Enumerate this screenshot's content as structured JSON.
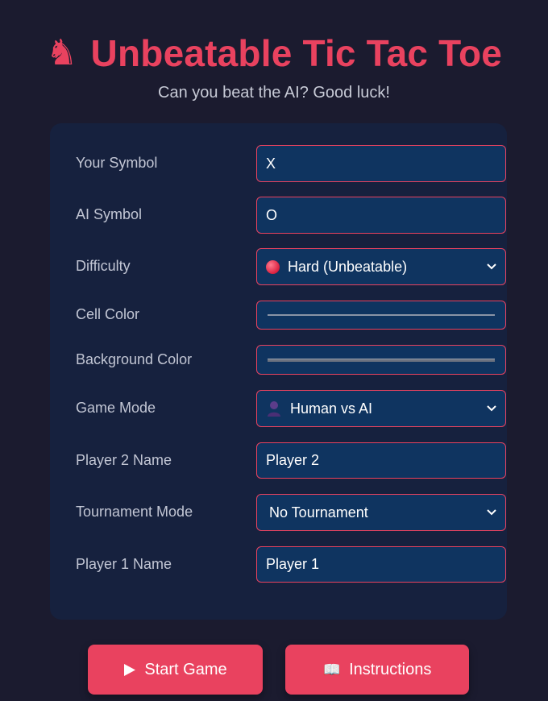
{
  "header": {
    "title": "Unbeatable Tic Tac Toe",
    "subtitle": "Can you beat the AI? Good luck!",
    "icon": "chess-knight-icon"
  },
  "form": {
    "your_symbol": {
      "label": "Your Symbol",
      "value": "X"
    },
    "ai_symbol": {
      "label": "AI Symbol",
      "value": "O"
    },
    "difficulty": {
      "label": "Difficulty",
      "value": "Hard (Unbeatable)",
      "icon": "red-circle-icon"
    },
    "cell_color": {
      "label": "Cell Color",
      "value": "#8a94a6"
    },
    "background_color": {
      "label": "Background Color",
      "value": "#6b7280"
    },
    "game_mode": {
      "label": "Game Mode",
      "value": "Human vs AI",
      "icon": "user-icon"
    },
    "player2_name": {
      "label": "Player 2 Name",
      "value": "Player 2"
    },
    "tournament_mode": {
      "label": "Tournament Mode",
      "value": "No Tournament"
    },
    "player1_name": {
      "label": "Player 1 Name",
      "value": "Player 1"
    }
  },
  "actions": {
    "start_label": "Start Game",
    "start_icon": "play-icon",
    "instructions_label": "Instructions",
    "instructions_icon": "book-icon"
  },
  "colors": {
    "background": "#1b1b2f",
    "panel": "#16213e",
    "field": "#0f3460",
    "accent": "#e9425f"
  }
}
